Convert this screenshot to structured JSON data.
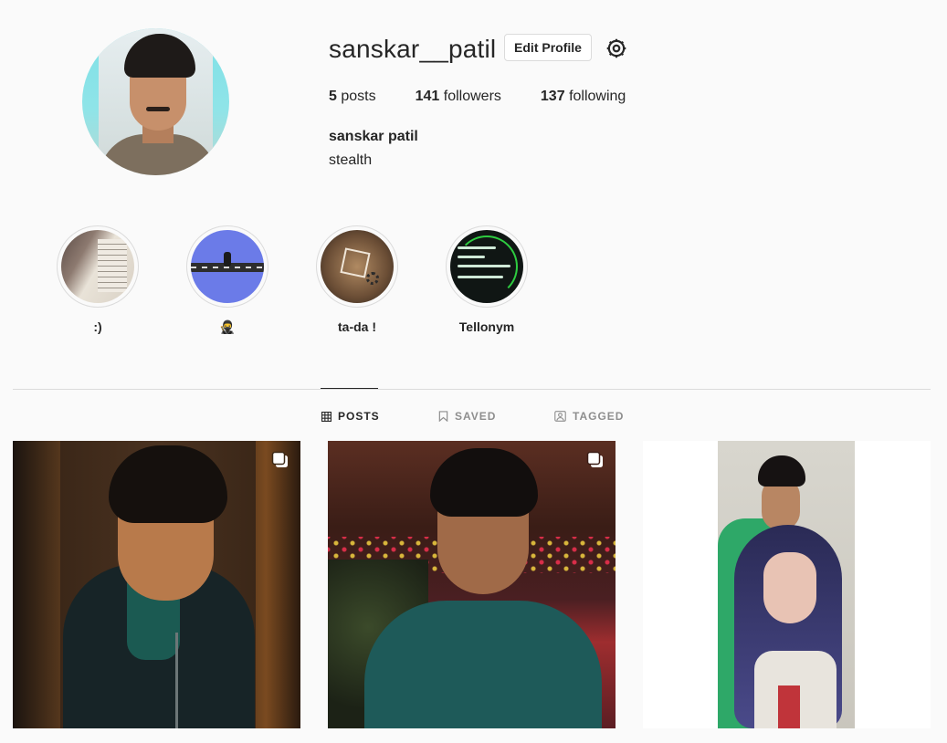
{
  "profile": {
    "username": "sanskar__patil",
    "edit_label": "Edit Profile",
    "full_name": "sanskar patil",
    "bio": "stealth",
    "stats": {
      "posts_count": "5",
      "posts_label": "posts",
      "followers_count": "141",
      "followers_label": "followers",
      "following_count": "137",
      "following_label": "following"
    }
  },
  "highlights": [
    {
      "label": ":)"
    },
    {
      "label": "🥷"
    },
    {
      "label": "ta-da !"
    },
    {
      "label": "Tellonym"
    }
  ],
  "tabs": [
    {
      "label": "POSTS",
      "icon": "grid-icon",
      "active": true
    },
    {
      "label": "SAVED",
      "icon": "bookmark-icon",
      "active": false
    },
    {
      "label": "TAGGED",
      "icon": "tag-person-icon",
      "active": false
    }
  ],
  "posts": [
    {
      "icon": "multi-post-icon"
    },
    {
      "icon": "multi-post-icon"
    },
    {}
  ],
  "colors": {
    "background": "#fafafa",
    "text": "#262626",
    "muted": "#8e8e8e",
    "border": "#dbdbdb"
  }
}
